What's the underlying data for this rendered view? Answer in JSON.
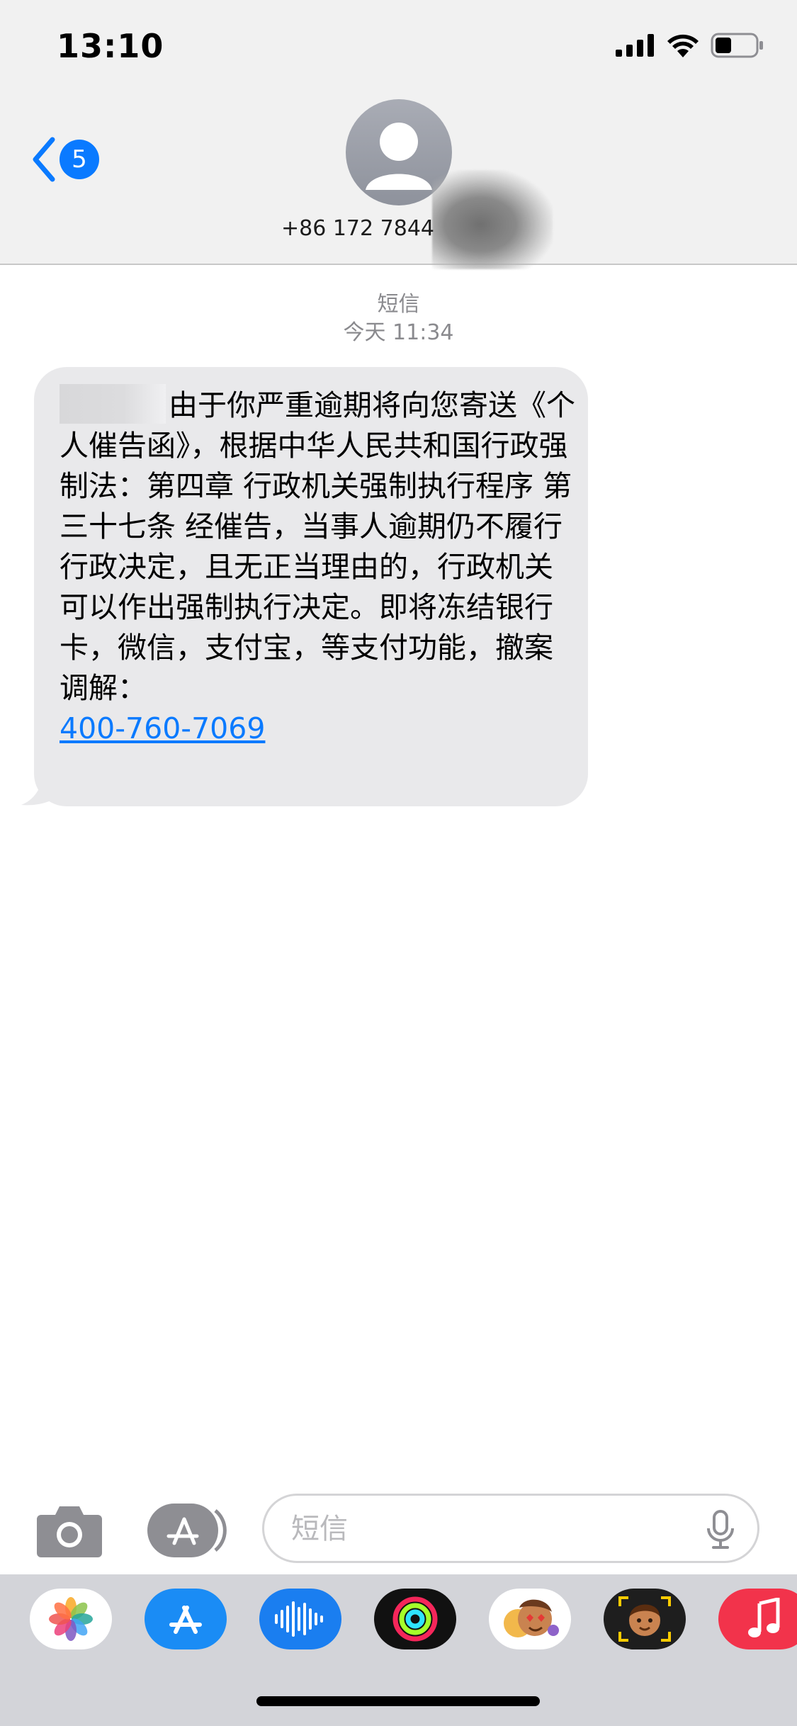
{
  "status_bar": {
    "time": "13:10",
    "icons": [
      "cellular-signal-icon",
      "wifi-icon",
      "battery-icon"
    ],
    "battery_level": 0.4
  },
  "header": {
    "back_count": "5",
    "contact_name": "+86 172 7844",
    "icons": [
      "back-chevron-icon",
      "contact-avatar-icon"
    ]
  },
  "thread": {
    "service_label": "短信",
    "timestamp": "今天 11:34",
    "message": {
      "text": "由于你严重逾期将向您寄送《个人催告函》，根据中华人民共和国行政强制法：第四章 行政机关强制执行程序 第三十七条 经催告，当事人逾期仍不履行行政决定，且无正当理由的，行政机关可以作出强制执行决定。即将冻结银行卡，微信，支付宝，等支付功能，撤案调解：",
      "phone_link": "400-760-7069"
    }
  },
  "input_bar": {
    "placeholder": "短信",
    "icons": [
      "camera-icon",
      "app-store-icon",
      "microphone-icon"
    ]
  },
  "app_strip": {
    "apps": [
      "photos-icon",
      "app-store-icon",
      "audio-message-icon",
      "activity-icon",
      "memoji-stickers-icon",
      "memoji-icon",
      "music-icon"
    ]
  },
  "colors": {
    "accent": "#0a7aff",
    "bubble": "#e9e9eb",
    "header_bg": "#f1f1f1",
    "app_strip_bg": "#d3d4d9"
  }
}
